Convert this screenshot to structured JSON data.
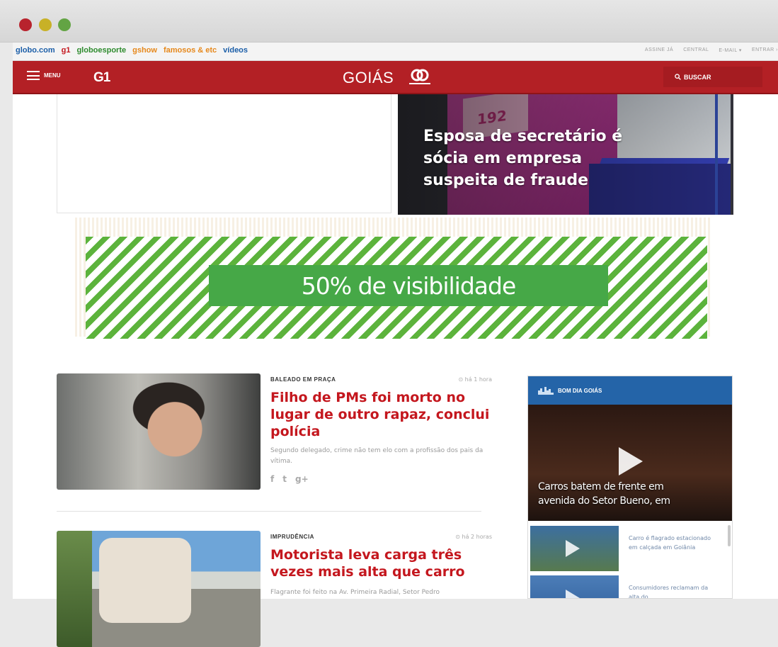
{
  "browser": {
    "dots": [
      "close",
      "minimize",
      "maximize"
    ]
  },
  "topbar": {
    "links": [
      {
        "label": "globo.com",
        "color": "#1b5ea8"
      },
      {
        "label": "g1",
        "color": "#c4171e"
      },
      {
        "label": "globoesporte",
        "color": "#2e8b2e"
      },
      {
        "label": "gshow",
        "color": "#e6881b"
      },
      {
        "label": "famosos & etc",
        "color": "#e6881b"
      },
      {
        "label": "vídeos",
        "color": "#1b5ea8"
      }
    ],
    "account": [
      "ASSINE JÁ",
      "CENTRAL",
      "E-MAIL ▾",
      "ENTRAR ›"
    ]
  },
  "header": {
    "menu_label": "MENU",
    "logo": "G1",
    "region": "GOIÁS",
    "search_label": "BUSCAR",
    "accent": "#b32025"
  },
  "hero": {
    "sign_text": "192",
    "headline": "Esposa de secretário é sócia em empresa suspeita de fraude"
  },
  "ad": {
    "label": "50% de visibilidade",
    "color": "#46a847"
  },
  "articles": [
    {
      "kicker": "BALEADO EM PRAÇA",
      "time": "⊙ há 1 hora",
      "headline": "Filho de PMs foi morto no lugar de outro rapaz, conclui polícia",
      "summary": "Segundo delegado, crime não tem elo com a profissão dos pais da vítima.",
      "social": [
        "f",
        "t",
        "g+"
      ]
    },
    {
      "kicker": "IMPRUDÊNCIA",
      "time": "⊙ há 2 horas",
      "headline": "Motorista leva carga três vezes mais alta que carro",
      "summary": "Flagrante foi feito na Av. Primeira Radial, Setor Pedro"
    }
  ],
  "sidebar": {
    "title": "BOM DIA GOIÁS",
    "main_video": "Carros batem de frente em avenida do Setor Bueno, em",
    "videos": [
      "Carro é flagrado estacionado em calçada em Goiânia",
      "Consumidores reclamam da alta do"
    ]
  }
}
